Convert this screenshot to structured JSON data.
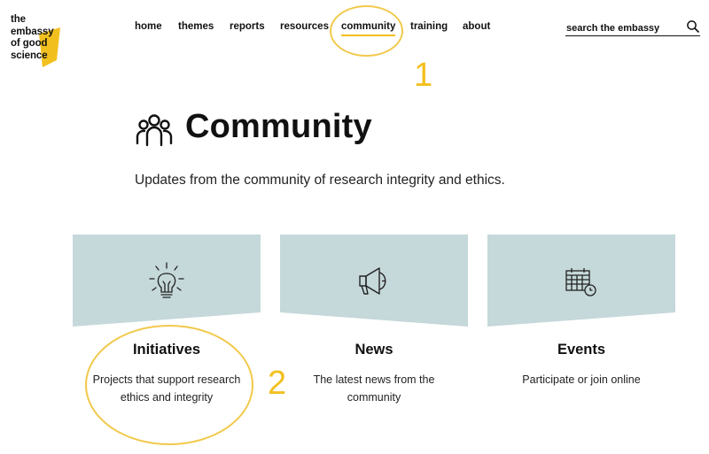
{
  "logo": {
    "lines": [
      "the",
      "embassy",
      "of good",
      "science"
    ]
  },
  "nav": {
    "items": [
      {
        "label": "home"
      },
      {
        "label": "themes"
      },
      {
        "label": "reports"
      },
      {
        "label": "resources"
      },
      {
        "label": "community"
      },
      {
        "label": "training"
      },
      {
        "label": "about"
      }
    ],
    "active": "community"
  },
  "search": {
    "placeholder": "search the embassy"
  },
  "annotations": {
    "one": "1",
    "two": "2",
    "color": "#f2c94c"
  },
  "page": {
    "title": "Community",
    "subtitle": "Updates from the community of research integrity and ethics."
  },
  "cards": [
    {
      "title": "Initiatives",
      "description": "Projects that support research ethics and integrity",
      "icon": "lightbulb-icon"
    },
    {
      "title": "News",
      "description": "The latest news from the community",
      "icon": "megaphone-icon"
    },
    {
      "title": "Events",
      "description": "Participate or join online",
      "icon": "calendar-icon"
    }
  ],
  "colors": {
    "accent": "#f2c01e",
    "card_banner": "#c5d8da",
    "text": "#111111"
  }
}
